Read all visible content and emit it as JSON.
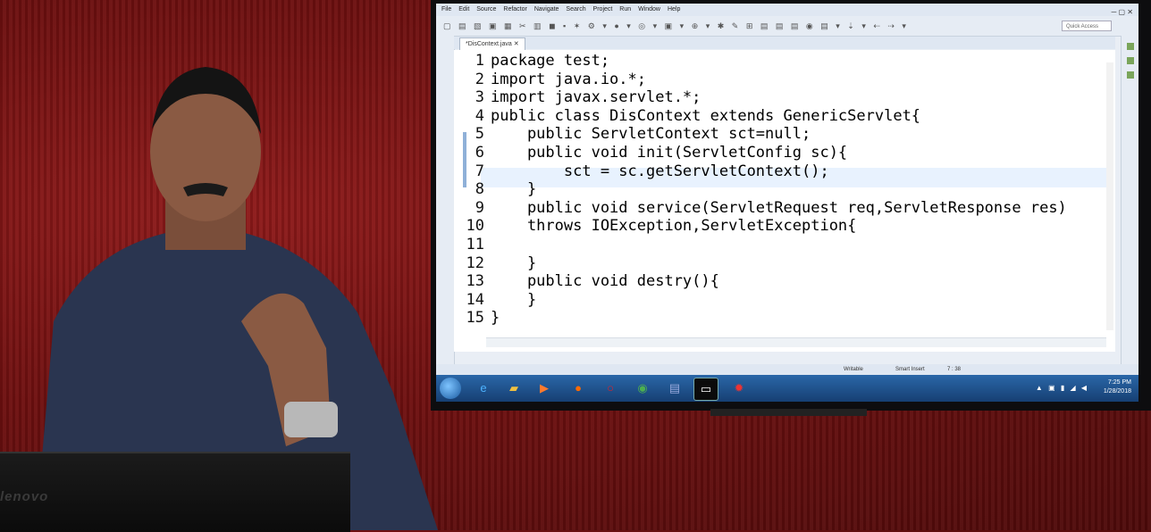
{
  "menu": [
    "File",
    "Edit",
    "Source",
    "Refactor",
    "Navigate",
    "Search",
    "Project",
    "Run",
    "Window",
    "Help"
  ],
  "quick_access": "Quick Access",
  "tab": {
    "title": "*DisContext.java",
    "close": "✕"
  },
  "window_controls": "─ ▢ ✕",
  "code_lines": [
    {
      "n": "1",
      "text": "package test;"
    },
    {
      "n": "2",
      "text": "import java.io.*;"
    },
    {
      "n": "3",
      "text": "import javax.servlet.*;"
    },
    {
      "n": "4",
      "text": "public class DisContext extends GenericServlet{"
    },
    {
      "n": "5",
      "text": "    public ServletContext sct=null;"
    },
    {
      "n": "6",
      "text": "    public void init(ServletConfig sc){"
    },
    {
      "n": "7",
      "text": "        sct = sc.getServletContext();"
    },
    {
      "n": "8",
      "text": "    }"
    },
    {
      "n": "9",
      "text": "    public void service(ServletRequest req,ServletResponse res)"
    },
    {
      "n": "10",
      "text": "    throws IOException,ServletException{"
    },
    {
      "n": "11",
      "text": ""
    },
    {
      "n": "12",
      "text": "    }"
    },
    {
      "n": "13",
      "text": "    public void destry(){"
    },
    {
      "n": "14",
      "text": "    }"
    },
    {
      "n": "15",
      "text": "}"
    }
  ],
  "status": {
    "writable": "Writable",
    "mode": "Smart Insert",
    "position": "7 : 38"
  },
  "clock": {
    "time": "7:25 PM",
    "date": "1/28/2018"
  },
  "taskbar_icons": [
    "ie-icon",
    "folder-icon",
    "media-player-icon",
    "firefox-icon",
    "opera-icon",
    "chrome-icon",
    "notepad-icon",
    "terminal-icon",
    "app-icon"
  ],
  "laptop_brand": "lenovo",
  "colors": {
    "curtain": "#6e1010",
    "eclipse_bg": "#e9eef5",
    "taskbar": "#1f5590",
    "highlight": "#e8f2fe"
  }
}
